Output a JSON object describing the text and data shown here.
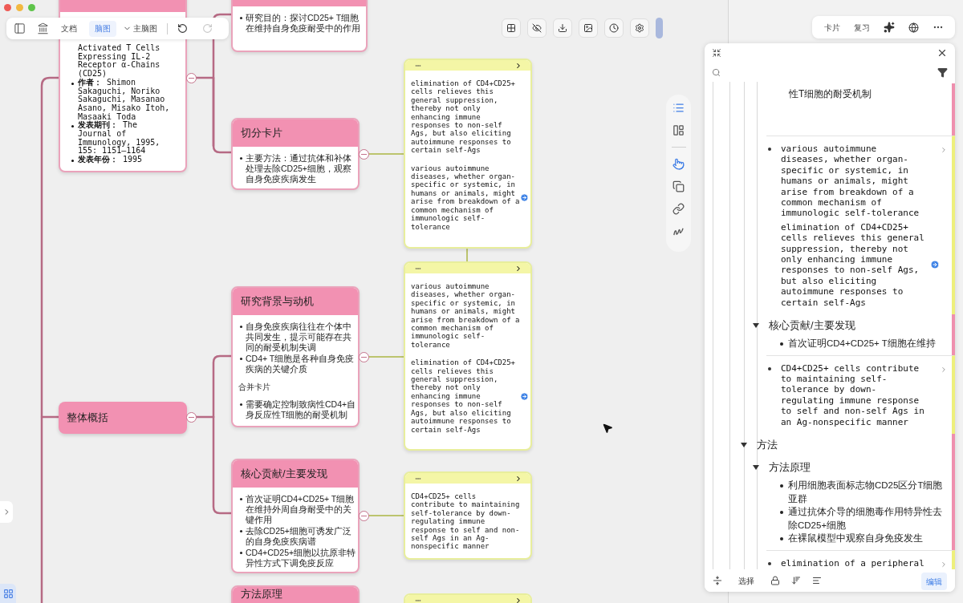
{
  "toolbar": {
    "tabs": [
      {
        "label": "文档",
        "selected": false
      },
      {
        "label": "脑图",
        "selected": true
      }
    ],
    "map_picker": "主脑图",
    "undo": {
      "disabled": false
    },
    "redo": {
      "disabled": true
    }
  },
  "side_tools": [
    {
      "kind": "list",
      "selected": true
    },
    {
      "kind": "layout",
      "selected": false
    },
    {
      "kind": "pointer",
      "selected": true
    },
    {
      "kind": "copy",
      "selected": false
    },
    {
      "kind": "link",
      "selected": false
    },
    {
      "kind": "draw",
      "selected": false
    }
  ],
  "mind_map": {
    "paper_card": {
      "title_tail": "Activated T Cells Expressing IL-2 Receptor α-Chains (CD25)",
      "items": [
        "**作者：** Shimon Sakaguchi, Noriko Sakaguchi, Masanao Asano, Misako Itoh, Masaaki Toda",
        "**发表期刊：** The Journal of Immunology, 1995, 155: 1151–1164",
        "**发表年份：** 1995"
      ]
    },
    "root": {
      "title": "整体概括"
    },
    "topics": [
      {
        "items": [
          "研究目的：探讨CD25+ T细胞在维持自身免疫耐受中的作用"
        ]
      },
      {
        "title": "切分卡片",
        "items": [
          "主要方法：通过抗体和补体处理去除CD25+细胞，观察自身免疫疾病发生"
        ]
      },
      {
        "title": "研究背景与动机",
        "items": [
          "自身免疫疾病往往在个体中共同发生，提示可能存在共同的耐受机制失调",
          "CD4+ T细胞是各种自身免疫疾病的关键介质"
        ],
        "merged": {
          "title": "合并卡片",
          "items": [
            "需要确定控制致病性CD4+自身反应性T细胞的耐受机制"
          ]
        }
      },
      {
        "title": "核心贡献/主要发现",
        "items": [
          "首次证明CD4+CD25+ T细胞在维持外周自身耐受中的关键作用",
          "去除CD25+细胞可诱发广泛的自身免疫疾病谱",
          "CD4+CD25+细胞以抗原非特异性方式下调免疫反应"
        ]
      },
      {
        "title": "方法原理"
      }
    ],
    "notes": [
      {
        "paragraphs": [
          "elimination of CD4+CD25+ cells relieves this general suppression, thereby not only enhancing immune responses to non-self Ags, but also eliciting autoimmune responses to certain self-Ags",
          "various autoimmune diseases, whether organ-specific or systemic, in humans or animals, might arise from breakdown of a common mechanism of immunologic self-tolerance"
        ],
        "linked": true
      },
      {
        "paragraphs": [
          "various autoimmune diseases, whether organ-specific or systemic, in humans or animals, might arise from breakdown of a common mechanism of immunologic self-tolerance",
          "elimination of CD4+CD25+ cells relieves this general suppression, thereby not only enhancing immune responses to non-self Ags, but also eliciting autoimmune responses to certain self-Ags"
        ],
        "linked": true
      },
      {
        "paragraphs": [
          "CD4+CD25+ cells contribute to maintaining self-tolerance by down-regulating immune response to self and non-self Ags in an Ag-nonspecific manner"
        ],
        "linked": false
      }
    ]
  },
  "right_toolbar": {
    "buttons": [
      "卡片",
      "复习"
    ]
  },
  "outline_panel": {
    "outline": [
      {
        "kind": "continued",
        "children": [
          {
            "kind": "tail",
            "text": "性T细胞的耐受机制"
          },
          {
            "kind": "note",
            "linked": true,
            "paragraphs": [
              "various autoimmune diseases, whether organ-specific or systemic, in humans or animals, might arise from breakdown of a common mechanism of immunologic self-tolerance",
              "elimination of CD4+CD25+ cells relieves this general suppression, thereby not only enhancing immune responses to non-self Ags, but also eliciting autoimmune responses to certain self-Ags"
            ]
          },
          {
            "kind": "heading",
            "text": "核心贡献/主要发现",
            "expanded": true,
            "children": [
              {
                "kind": "bullet",
                "text": "首次证明CD4+CD25+ T细胞在维持"
              },
              {
                "kind": "note",
                "linked": false,
                "paragraphs": [
                  "CD4+CD25+ cells contribute to maintaining self-tolerance by down-regulating immune response to self and non-self Ags in an Ag-nonspecific manner"
                ]
              }
            ]
          }
        ]
      },
      {
        "kind": "heading",
        "text": "方法",
        "expanded": true,
        "children": [
          {
            "kind": "heading",
            "text": "方法原理",
            "expanded": true,
            "children": [
              {
                "kind": "bullet",
                "text": "利用细胞表面标志物CD25区分T细胞亚群"
              },
              {
                "kind": "bullet",
                "text": "通过抗体介导的细胞毒作用特异性去除CD25+细胞"
              },
              {
                "kind": "bullet",
                "text": "在裸鼠模型中观察自身免疫发生"
              }
            ]
          },
          {
            "kind": "note",
            "linked": false,
            "paragraphs": [
              "elimination of a peripheral"
            ]
          }
        ]
      }
    ],
    "footer": {
      "buttons": [
        {
          "label": "选择",
          "selected": false
        },
        {
          "label": "编辑",
          "selected": true
        }
      ]
    }
  }
}
